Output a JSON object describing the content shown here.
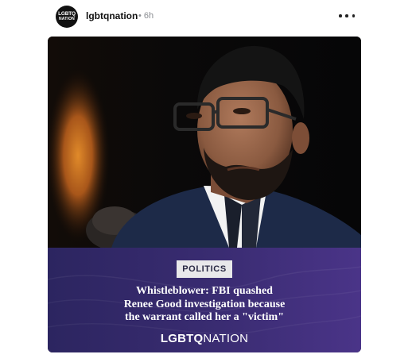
{
  "post": {
    "avatar_line1": "LGBTQ",
    "avatar_line2": "NATION",
    "username": "lgbtqnation",
    "separator": "•",
    "time_ago": "6h",
    "more_icon": "more-horizontal-icon"
  },
  "card": {
    "category": "POLITICS",
    "headline_lines": [
      "Whistleblower: FBI quashed",
      "Renee Good investigation because",
      "the warrant called her a \"victim\""
    ],
    "brand_bold": "LGBTQ",
    "brand_regular": "NATION"
  },
  "colors": {
    "banner": "#3a2c72",
    "tag_bg": "#e8e8ea",
    "photo_bg": "#0b0b0c"
  }
}
